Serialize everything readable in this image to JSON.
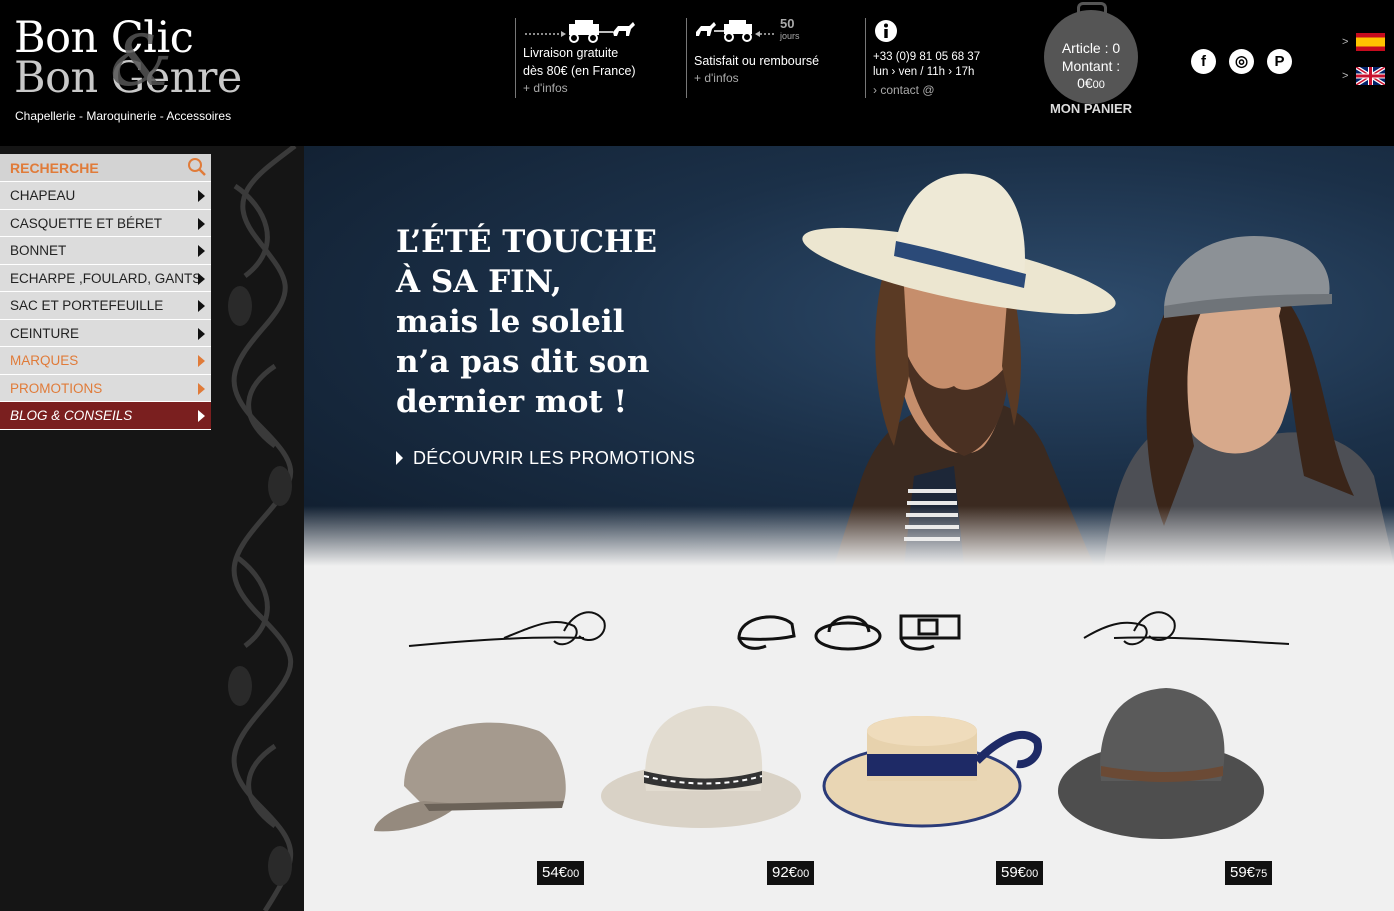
{
  "brand": {
    "line1": "Bon Clic",
    "line2": "Bon Genre",
    "tagline": "Chapellerie - Maroquinerie - Accessoires"
  },
  "header": {
    "livraison": {
      "title_line1": "Livraison gratuite",
      "title_line2": "dès 80€ (en France)",
      "more": "+ d'infos"
    },
    "satisfait": {
      "days_number": "50",
      "days_label": "jours",
      "title": "Satisfait ou remboursé",
      "more": "+ d'infos"
    },
    "contact": {
      "phone": "+33 (0)9 81 05 68 37",
      "hours": "lun › ven / 11h › 17h",
      "link": "› contact @"
    },
    "cart": {
      "article_line": "Article : 0",
      "montant_label": "Montant :",
      "amount_main": "0€",
      "amount_cents": "00",
      "label": "MON PANIER"
    },
    "social": {
      "facebook": "f",
      "instagram": "◎",
      "pinterest": "P"
    },
    "languages": {
      "es": ">",
      "en": ">"
    }
  },
  "sidebar": {
    "search_label": "RECHERCHE",
    "items": [
      {
        "label": "CHAPEAU"
      },
      {
        "label": "CASQUETTE ET BÉRET"
      },
      {
        "label": "BONNET"
      },
      {
        "label": "ECHARPE ,FOULARD, GANTS"
      },
      {
        "label": "SAC ET PORTEFEUILLE"
      },
      {
        "label": "CEINTURE"
      },
      {
        "label": "MARQUES"
      },
      {
        "label": "PROMOTIONS"
      },
      {
        "label": "BLOG & CONSEILS"
      }
    ]
  },
  "hero": {
    "line1": "L’ÉTÉ TOUCHE",
    "line2": "À SA FIN,",
    "line3": "mais le soleil",
    "line4": "n’a pas dit son",
    "line5": "dernier mot !",
    "cta": "DÉCOUVRIR LES PROMOTIONS"
  },
  "products": [
    {
      "name": "linen-baseball-cap",
      "price_main": "54€",
      "price_cents": "00"
    },
    {
      "name": "beige-fedora",
      "price_main": "92€",
      "price_cents": "00"
    },
    {
      "name": "straw-boater",
      "price_main": "59€",
      "price_cents": "00"
    },
    {
      "name": "grey-felt-hat",
      "price_main": "59€",
      "price_cents": "75"
    }
  ],
  "colors": {
    "accent_orange": "#e07b39",
    "blog_bg": "#7a1f1f",
    "header_bg": "#000000"
  }
}
